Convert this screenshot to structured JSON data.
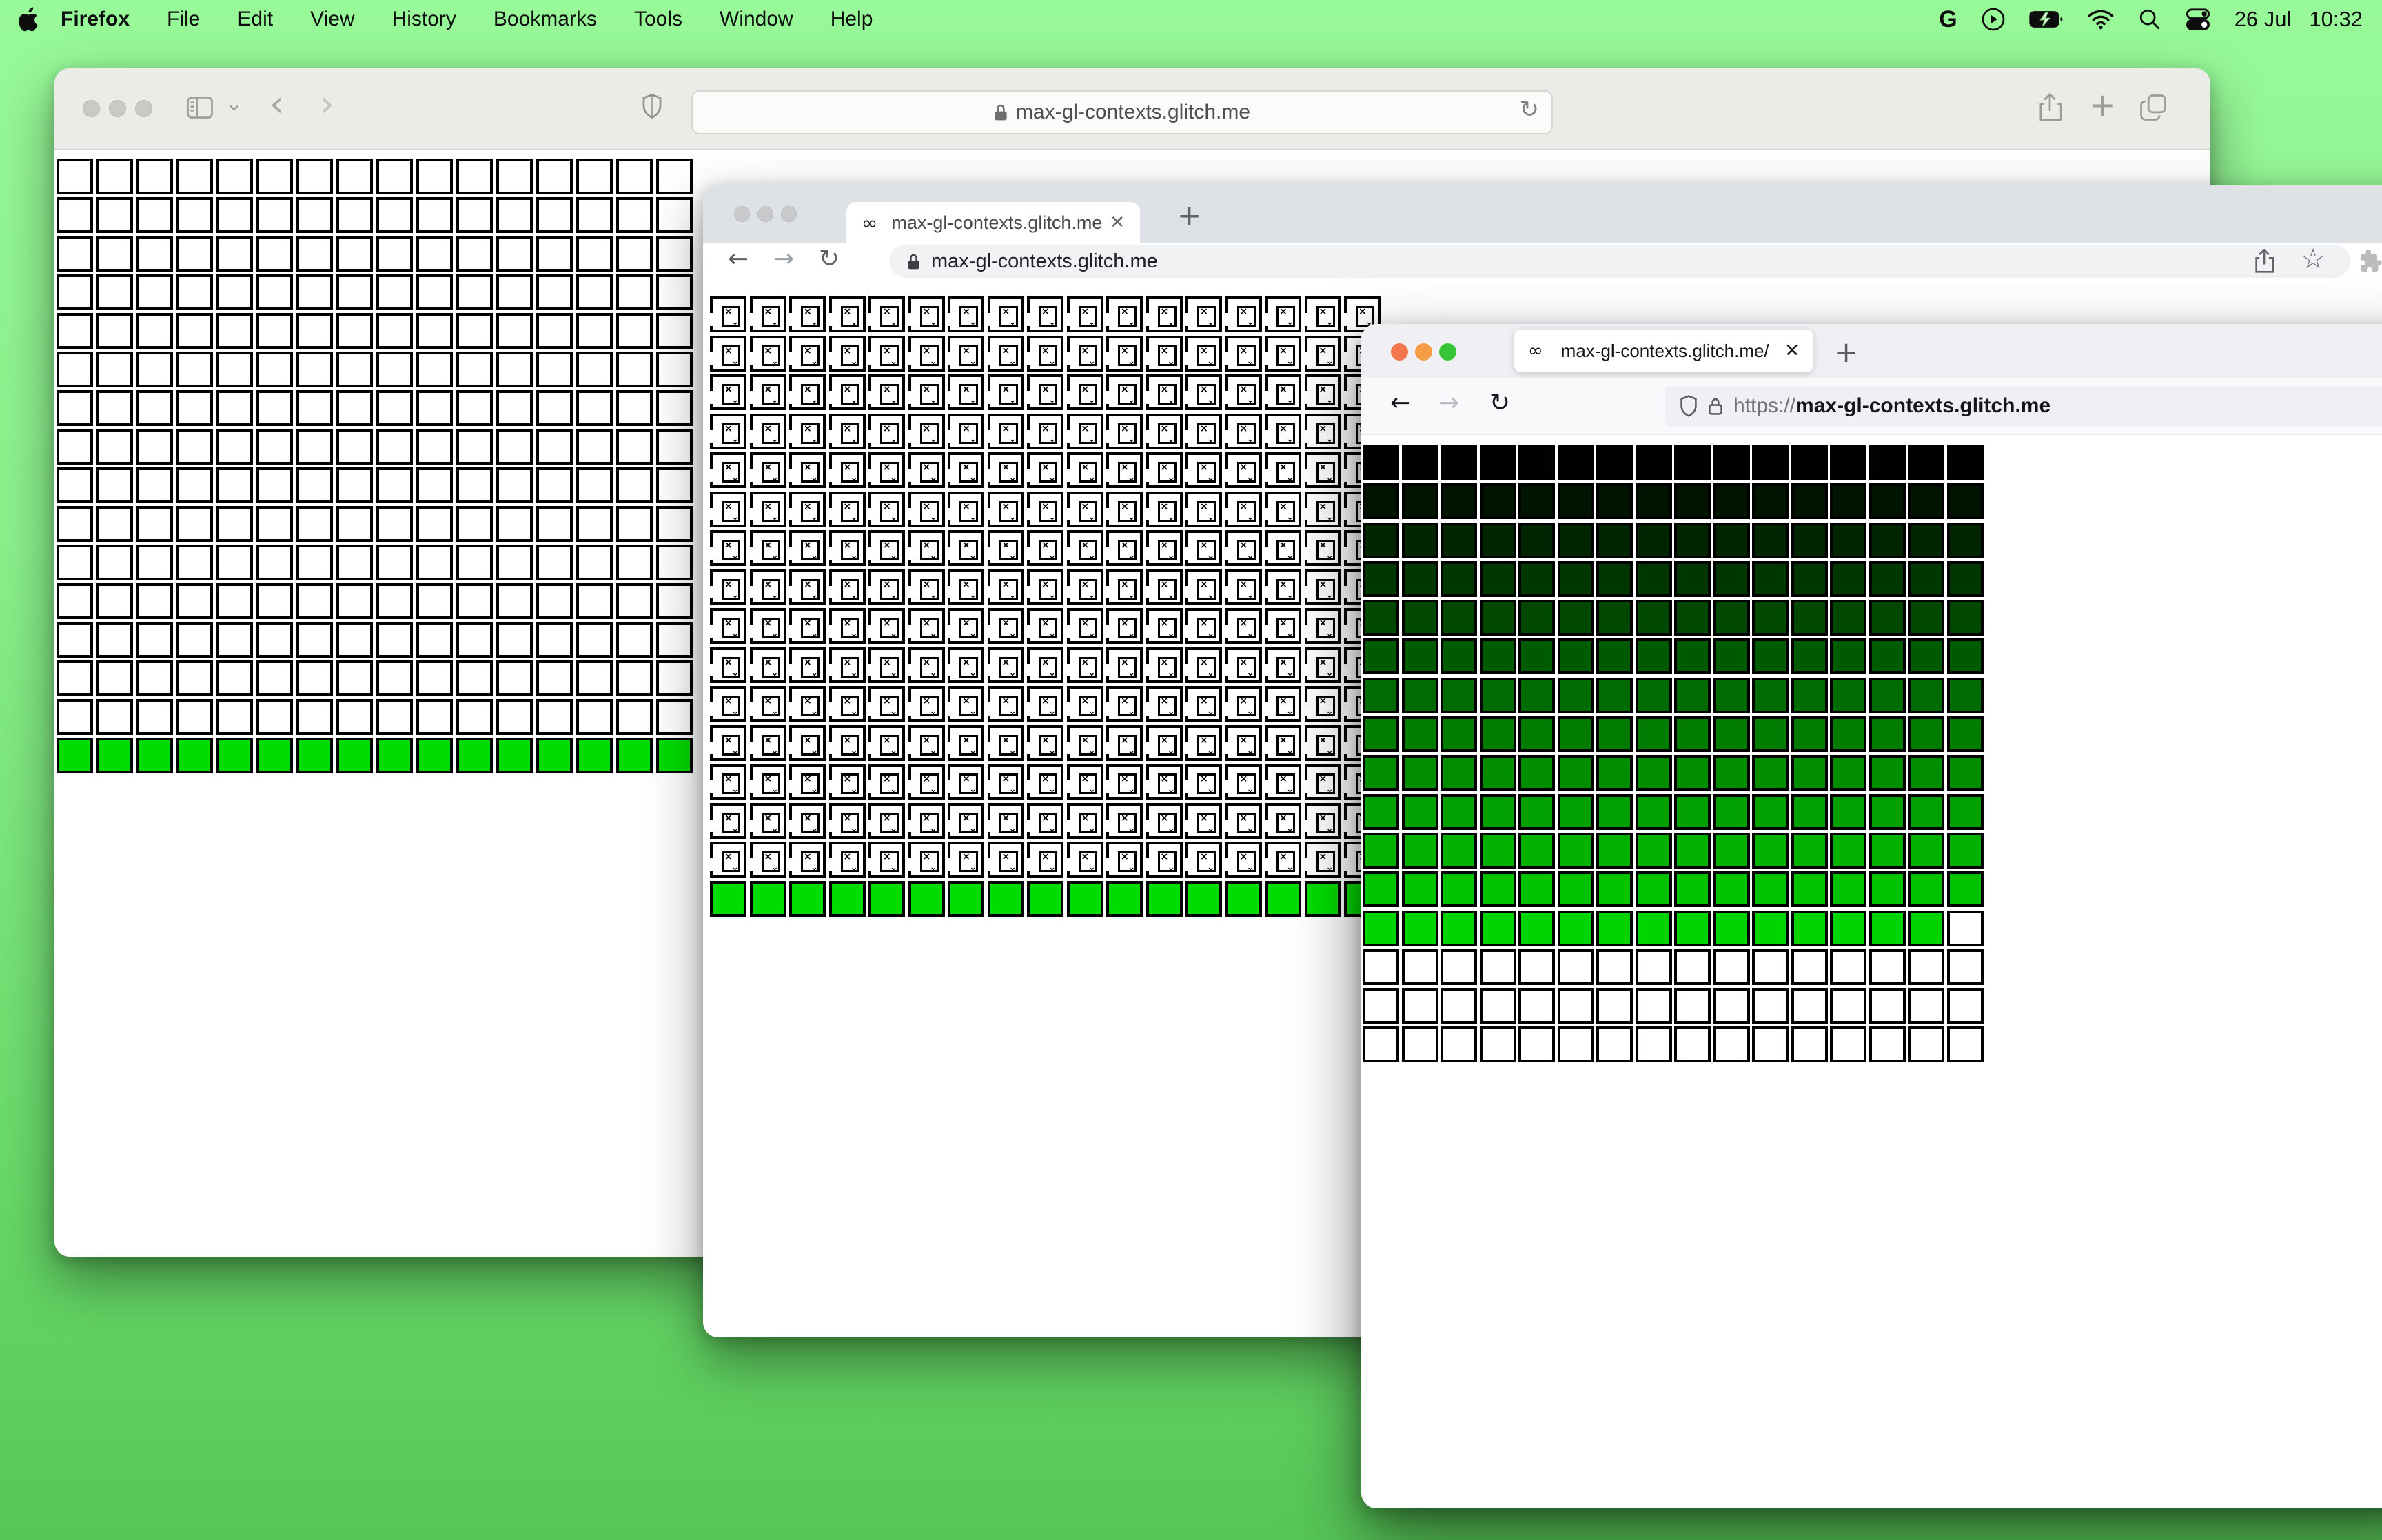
{
  "menu_bar": {
    "app_name": "Firefox",
    "menus": [
      "File",
      "Edit",
      "View",
      "History",
      "Bookmarks",
      "Tools",
      "Window",
      "Help"
    ],
    "google_g": "G",
    "date": "26 Jul",
    "time": "10:32"
  },
  "safari_window": {
    "url": "max-gl-contexts.glitch.me",
    "grid": {
      "cols": 16,
      "rows": 16,
      "bottom_green_rows": 1,
      "green": "#00DC00"
    }
  },
  "chrome_window": {
    "tab_title": "max-gl-contexts.glitch.me",
    "url": "max-gl-contexts.glitch.me",
    "grid": {
      "cols": 17,
      "rows": 16,
      "bottom_green_rows": 1,
      "green": "#00DC00",
      "cell_fill": "broken",
      "glyph_x": "×",
      "glyph_squiggle": "⌄"
    }
  },
  "firefox_window": {
    "tab_title": "max-gl-contexts.glitch.me/",
    "url_scheme": "https://",
    "url_host": "max-gl-contexts.glitch.me",
    "grid": {
      "cols": 16,
      "rows": 16,
      "row_colors": [
        "#000200",
        "#001400",
        "#002500",
        "#003700",
        "#004800",
        "#005A00",
        "#006B00",
        "#007D00",
        "#008E00",
        "#00A000",
        "#00B100",
        "#00C300",
        "#00D400",
        "#FFFFFF",
        "#FFFFFF",
        "#FFFFFF"
      ],
      "white_cell": {
        "row": 12,
        "col": 15
      }
    }
  },
  "glyphs": {
    "infinity": "∞",
    "close_tab": "✕",
    "new_tab": "+",
    "back": "←",
    "forward": "→",
    "reload": "↻",
    "back_chev": "‹",
    "forward_chev": "›",
    "chevron_down": "⌄",
    "star": "☆"
  }
}
